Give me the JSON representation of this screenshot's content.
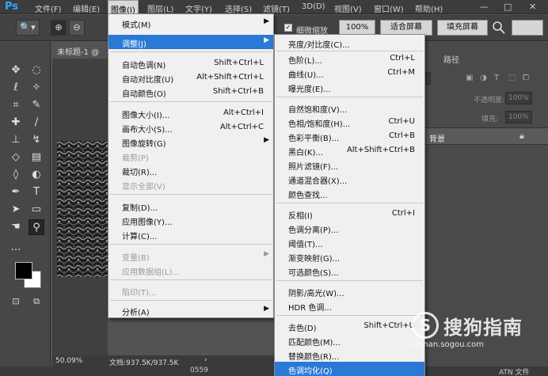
{
  "app": {
    "logo": "Ps"
  },
  "menubar": {
    "items": [
      "文件(F)",
      "编辑(E)",
      "图像(I)",
      "图层(L)",
      "文字(Y)",
      "选择(S)",
      "滤镜(T)",
      "3D(D)",
      "视图(V)",
      "窗口(W)",
      "帮助(H)"
    ],
    "window_controls": {
      "minimize": "—",
      "maximize": "□",
      "close": "✕"
    }
  },
  "options_bar": {
    "zoom_dropdown": "🔍▾",
    "zoom_in": "⊕",
    "zoom_out": "⊖",
    "scrubby_zoom_checkbox": "✓",
    "scrubby_zoom_label": "细微缩放",
    "zoom_percent": "100%",
    "fit_screen": "适合屏幕",
    "fill_screen": "填充屏幕"
  },
  "document": {
    "tab_title": "未标题-1 @",
    "zoom": "50.09%",
    "doc_info": "文档:937.5K/937.5K",
    "status_arrow": "›"
  },
  "panels": {
    "tab_paths": "路径",
    "opacity_label": "不透明度:",
    "opacity_value": "100%",
    "fill_label": "填充:",
    "fill_value": "100%",
    "layer_name": "背景",
    "bottom_text_left": "0559",
    "bottom_text_right": "ATN 文件"
  },
  "image_menu": {
    "items": [
      {
        "label": "模式(M)",
        "shortcut": "",
        "submenu": true,
        "disabled": false
      },
      {
        "label": "调整(J)",
        "shortcut": "",
        "submenu": true,
        "disabled": false,
        "highlighted": true
      },
      {
        "label": "自动色调(N)",
        "shortcut": "Shift+Ctrl+L"
      },
      {
        "label": "自动对比度(U)",
        "shortcut": "Alt+Shift+Ctrl+L"
      },
      {
        "label": "自动颜色(O)",
        "shortcut": "Shift+Ctrl+B"
      },
      {
        "label": "图像大小(I)...",
        "shortcut": "Alt+Ctrl+I"
      },
      {
        "label": "画布大小(S)...",
        "shortcut": "Alt+Ctrl+C"
      },
      {
        "label": "图像旋转(G)",
        "shortcut": "",
        "submenu": true
      },
      {
        "label": "裁剪(P)",
        "shortcut": "",
        "disabled": true
      },
      {
        "label": "裁切(R)...",
        "shortcut": ""
      },
      {
        "label": "显示全部(V)",
        "shortcut": "",
        "disabled": true
      },
      {
        "label": "复制(D)...",
        "shortcut": ""
      },
      {
        "label": "应用图像(Y)...",
        "shortcut": ""
      },
      {
        "label": "计算(C)...",
        "shortcut": ""
      },
      {
        "label": "变量(B)",
        "shortcut": "",
        "submenu": true,
        "disabled": true
      },
      {
        "label": "应用数据组(L)...",
        "shortcut": "",
        "disabled": true
      },
      {
        "label": "陷印(T)...",
        "shortcut": "",
        "disabled": true
      },
      {
        "label": "分析(A)",
        "shortcut": "",
        "submenu": true
      }
    ]
  },
  "adjust_menu": {
    "items": [
      {
        "label": "亮度/对比度(C)...",
        "shortcut": ""
      },
      {
        "label": "色阶(L)...",
        "shortcut": "Ctrl+L"
      },
      {
        "label": "曲线(U)...",
        "shortcut": "Ctrl+M"
      },
      {
        "label": "曝光度(E)...",
        "shortcut": ""
      },
      {
        "label": "自然饱和度(V)...",
        "shortcut": ""
      },
      {
        "label": "色相/饱和度(H)...",
        "shortcut": "Ctrl+U"
      },
      {
        "label": "色彩平衡(B)...",
        "shortcut": "Ctrl+B"
      },
      {
        "label": "黑白(K)...",
        "shortcut": "Alt+Shift+Ctrl+B"
      },
      {
        "label": "照片滤镜(F)...",
        "shortcut": ""
      },
      {
        "label": "通道混合器(X)...",
        "shortcut": ""
      },
      {
        "label": "颜色查找...",
        "shortcut": ""
      },
      {
        "label": "反相(I)",
        "shortcut": "Ctrl+I"
      },
      {
        "label": "色调分离(P)...",
        "shortcut": ""
      },
      {
        "label": "阈值(T)...",
        "shortcut": ""
      },
      {
        "label": "渐变映射(G)...",
        "shortcut": ""
      },
      {
        "label": "可选颜色(S)...",
        "shortcut": ""
      },
      {
        "label": "阴影/高光(W)...",
        "shortcut": ""
      },
      {
        "label": "HDR 色调...",
        "shortcut": ""
      },
      {
        "label": "去色(D)",
        "shortcut": "Shift+Ctrl+U"
      },
      {
        "label": "匹配颜色(M)...",
        "shortcut": ""
      },
      {
        "label": "替换颜色(R)...",
        "shortcut": ""
      },
      {
        "label": "色调均化(Q)",
        "shortcut": "",
        "highlighted": true
      }
    ]
  },
  "watermark": {
    "logo_glyph": "S",
    "name": "搜狗指南",
    "url": "zhinan.sogou.com"
  }
}
